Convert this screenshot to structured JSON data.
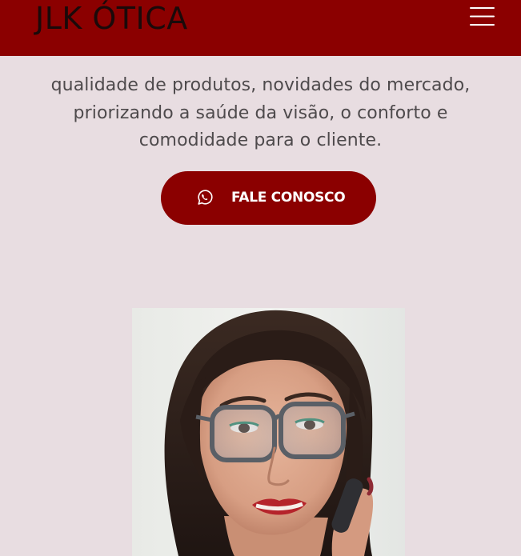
{
  "header": {
    "logo": "JLK ÓTICA",
    "menu_icon": "hamburger-menu-icon",
    "background": "#8b0000"
  },
  "intro": {
    "lines": [
      "qualidade de produtos, novidades do mercado,",
      "priorizando a saúde da visão, o conforto e",
      "comodidade para o cliente."
    ]
  },
  "cta": {
    "label": "FALE CONOSCO",
    "icon": "whatsapp-icon",
    "color": "#8b0000"
  },
  "page": {
    "background": "#e8dde1"
  }
}
